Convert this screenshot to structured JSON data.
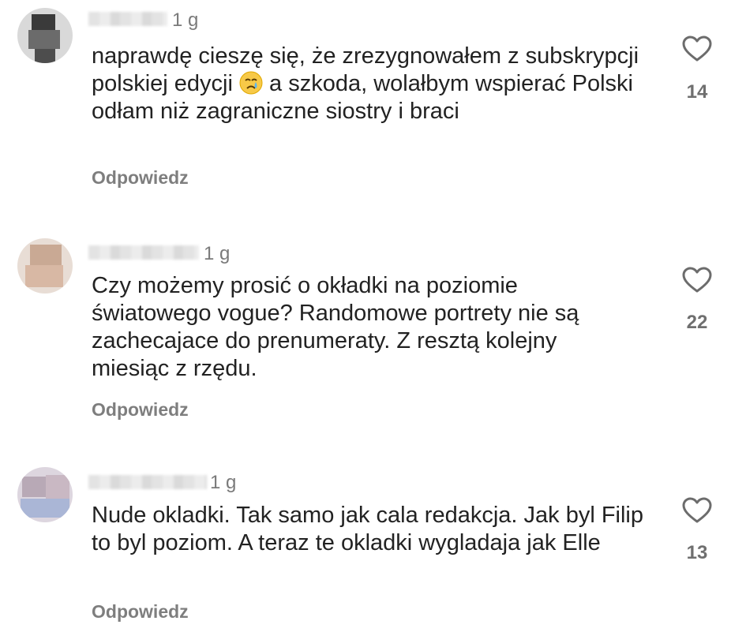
{
  "comments": [
    {
      "time": "1 g",
      "text_before_emoji": "naprawdę cieszę się, że zrezygnowałem z subskrypcji polskiej edycji",
      "emoji": "crying-face",
      "text_after_emoji": " a szkoda, wolałbym wspierać Polski odłam niż zagraniczne siostry i braci",
      "reply_label": "Odpowiedz",
      "likes": "14"
    },
    {
      "time": "1 g",
      "text": "Czy możemy prosić o okładki na poziomie światowego vogue? Randomowe portrety nie są zachecajace do prenumeraty. Z resztą kolejny miesiąc z rzędu.",
      "reply_label": "Odpowiedz",
      "likes": "22"
    },
    {
      "time": "1 g",
      "text": "Nude okladki. Tak samo jak cala redakcja. Jak byl Filip to byl poziom. A teraz te okladki wygladaja jak Elle",
      "reply_label": "Odpowiedz",
      "likes": "13"
    }
  ],
  "icons": {
    "like": "heart-outline-icon"
  }
}
